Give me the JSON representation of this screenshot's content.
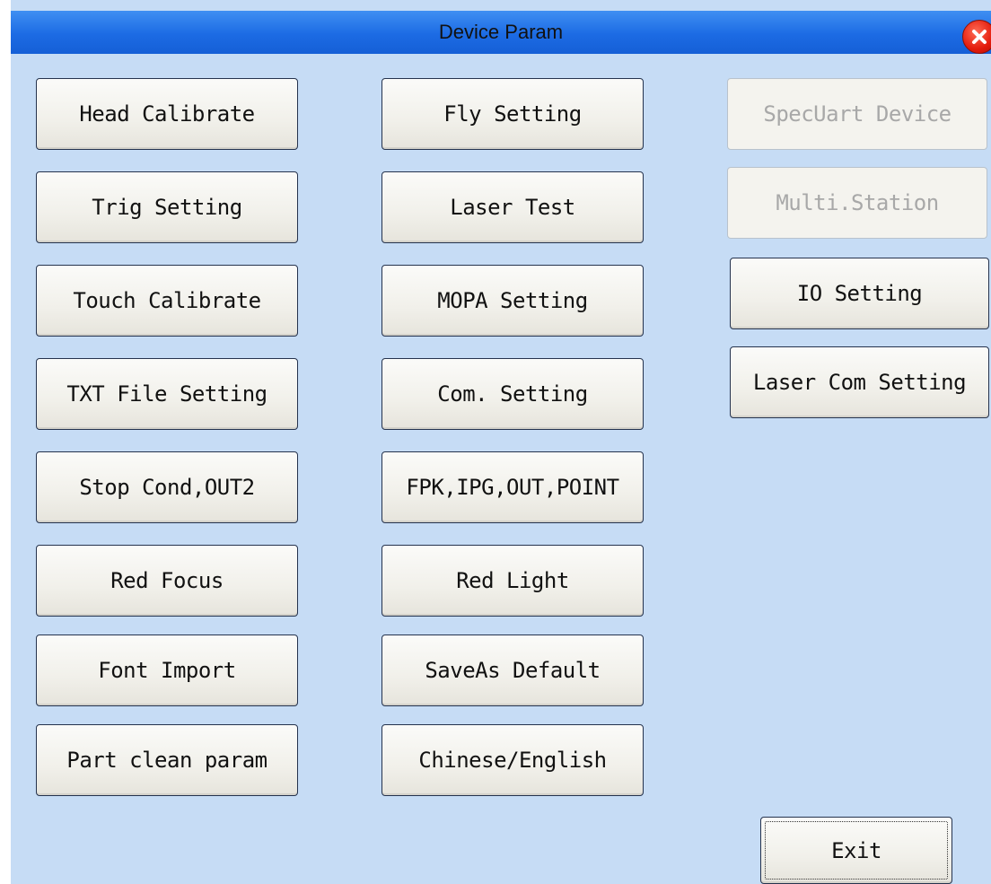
{
  "window": {
    "title": "Device Param",
    "close_icon": "close-icon"
  },
  "column1": [
    "Head Calibrate",
    "Trig Setting",
    "Touch Calibrate",
    "TXT File Setting",
    "Stop Cond,OUT2",
    "Red Focus",
    "Font Import",
    "Part clean param"
  ],
  "column2": [
    "Fly Setting",
    "Laser Test",
    "MOPA Setting",
    "Com. Setting",
    "FPK,IPG,OUT,POINT",
    "Red Light",
    "SaveAs Default",
    "Chinese/English"
  ],
  "column3": [
    {
      "label": "SpecUart Device",
      "enabled": false
    },
    {
      "label": "Multi.Station",
      "enabled": false
    },
    {
      "label": "IO Setting",
      "enabled": true
    },
    {
      "label": "Laser Com Setting",
      "enabled": true
    }
  ],
  "exit_label": "Exit",
  "colors": {
    "background": "#c6dcf5",
    "titlebar": "#1c6be4",
    "close_button": "#e31b0c"
  }
}
